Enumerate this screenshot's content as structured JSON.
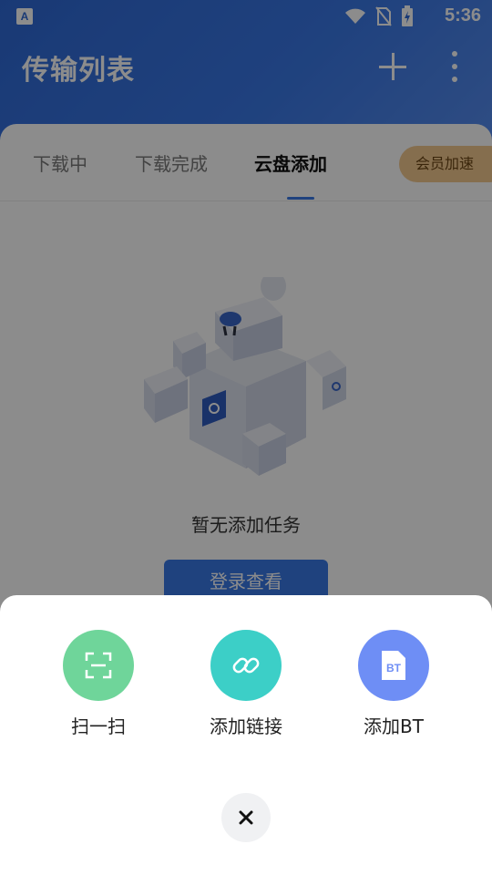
{
  "status_bar": {
    "time": "5:36",
    "app_indicator": "A"
  },
  "header": {
    "title": "传输列表",
    "add_icon": "plus-icon",
    "more_icon": "more-vertical-icon"
  },
  "tabs": [
    {
      "label": "下载中"
    },
    {
      "label": "下载完成"
    },
    {
      "label": "云盘添加"
    }
  ],
  "vip_badge": "会员加速",
  "empty_state": {
    "text": "暂无添加任务",
    "button": "登录查看"
  },
  "sheet": {
    "actions": [
      {
        "label": "扫一扫",
        "icon": "scan-icon",
        "color": "#6fd59a"
      },
      {
        "label": "添加链接",
        "icon": "link-icon",
        "color": "#3ccfc7"
      },
      {
        "label": "添加BT",
        "icon": "bt-file-icon",
        "color": "#6e8ef5",
        "icon_text": "BT"
      }
    ],
    "close_icon": "close-icon"
  },
  "colors": {
    "primary": "#3a78e6",
    "vip": "#f3c88f"
  }
}
